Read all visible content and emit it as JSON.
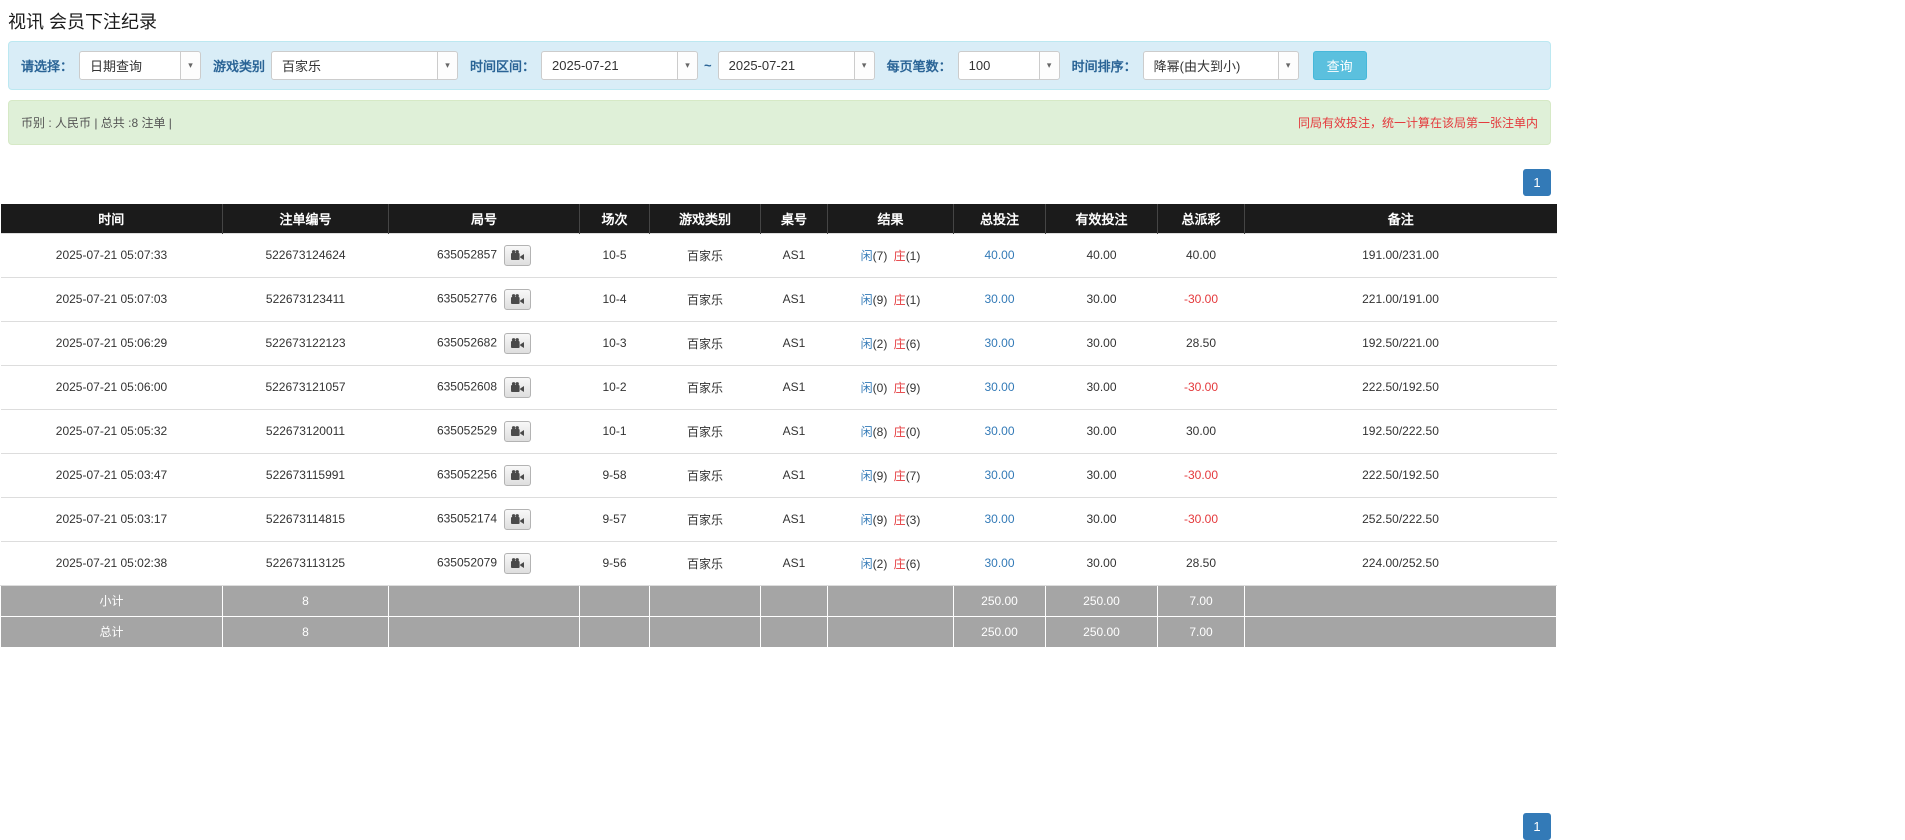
{
  "page": {
    "title": "视讯 会员下注纪录"
  },
  "filters": {
    "select_label": "请选择：",
    "select_value": "日期查询",
    "game_type_label": "游戏类别",
    "game_type_value": "百家乐",
    "date_range_label": "时间区间：",
    "date_from": "2025-07-21",
    "date_separator": "~",
    "date_to": "2025-07-21",
    "page_size_label": "每页笔数：",
    "page_size_value": "100",
    "sort_label": "时间排序：",
    "sort_value": "降幂(由大到小)",
    "search_button": "查询"
  },
  "summary": {
    "left_text": "币别 : 人民币 | 总共 :8 注单 |",
    "right_notice": "同局有效投注，统一计算在该局第一张注单内"
  },
  "pagination": {
    "page": "1"
  },
  "table": {
    "headers": [
      "时间",
      "注单编号",
      "局号",
      "场次",
      "游戏类别",
      "桌号",
      "结果",
      "总投注",
      "有效投注",
      "总派彩",
      "备注"
    ],
    "rows": [
      {
        "time": "2025-07-21 05:07:33",
        "bet_id": "522673124624",
        "round_id": "635052857",
        "session": "10-5",
        "game": "百家乐",
        "table_no": "AS1",
        "result_player": "闲",
        "result_player_score": "(7)",
        "result_banker": "庄",
        "result_banker_score": "(1)",
        "total_bet": "40.00",
        "valid_bet": "40.00",
        "payout": "40.00",
        "remark": "191.00/231.00"
      },
      {
        "time": "2025-07-21 05:07:03",
        "bet_id": "522673123411",
        "round_id": "635052776",
        "session": "10-4",
        "game": "百家乐",
        "table_no": "AS1",
        "result_player": "闲",
        "result_player_score": "(9)",
        "result_banker": "庄",
        "result_banker_score": "(1)",
        "total_bet": "30.00",
        "valid_bet": "30.00",
        "payout": "-30.00",
        "remark": "221.00/191.00"
      },
      {
        "time": "2025-07-21 05:06:29",
        "bet_id": "522673122123",
        "round_id": "635052682",
        "session": "10-3",
        "game": "百家乐",
        "table_no": "AS1",
        "result_player": "闲",
        "result_player_score": "(2)",
        "result_banker": "庄",
        "result_banker_score": "(6)",
        "total_bet": "30.00",
        "valid_bet": "30.00",
        "payout": "28.50",
        "remark": "192.50/221.00"
      },
      {
        "time": "2025-07-21 05:06:00",
        "bet_id": "522673121057",
        "round_id": "635052608",
        "session": "10-2",
        "game": "百家乐",
        "table_no": "AS1",
        "result_player": "闲",
        "result_player_score": "(0)",
        "result_banker": "庄",
        "result_banker_score": "(9)",
        "total_bet": "30.00",
        "valid_bet": "30.00",
        "payout": "-30.00",
        "remark": "222.50/192.50"
      },
      {
        "time": "2025-07-21 05:05:32",
        "bet_id": "522673120011",
        "round_id": "635052529",
        "session": "10-1",
        "game": "百家乐",
        "table_no": "AS1",
        "result_player": "闲",
        "result_player_score": "(8)",
        "result_banker": "庄",
        "result_banker_score": "(0)",
        "total_bet": "30.00",
        "valid_bet": "30.00",
        "payout": "30.00",
        "remark": "192.50/222.50"
      },
      {
        "time": "2025-07-21 05:03:47",
        "bet_id": "522673115991",
        "round_id": "635052256",
        "session": "9-58",
        "game": "百家乐",
        "table_no": "AS1",
        "result_player": "闲",
        "result_player_score": "(9)",
        "result_banker": "庄",
        "result_banker_score": "(7)",
        "total_bet": "30.00",
        "valid_bet": "30.00",
        "payout": "-30.00",
        "remark": "222.50/192.50"
      },
      {
        "time": "2025-07-21 05:03:17",
        "bet_id": "522673114815",
        "round_id": "635052174",
        "session": "9-57",
        "game": "百家乐",
        "table_no": "AS1",
        "result_player": "闲",
        "result_player_score": "(9)",
        "result_banker": "庄",
        "result_banker_score": "(3)",
        "total_bet": "30.00",
        "valid_bet": "30.00",
        "payout": "-30.00",
        "remark": "252.50/222.50"
      },
      {
        "time": "2025-07-21 05:02:38",
        "bet_id": "522673113125",
        "round_id": "635052079",
        "session": "9-56",
        "game": "百家乐",
        "table_no": "AS1",
        "result_player": "闲",
        "result_player_score": "(2)",
        "result_banker": "庄",
        "result_banker_score": "(6)",
        "total_bet": "30.00",
        "valid_bet": "30.00",
        "payout": "28.50",
        "remark": "224.00/252.50"
      }
    ],
    "subtotal": {
      "label": "小计",
      "count": "8",
      "total_bet": "250.00",
      "valid_bet": "250.00",
      "payout": "7.00"
    },
    "total": {
      "label": "总计",
      "count": "8",
      "total_bet": "250.00",
      "valid_bet": "250.00",
      "payout": "7.00"
    }
  },
  "colors": {
    "player_blue": "#337ab7",
    "banker_red": "#e4393c",
    "negative_red": "#e4393c",
    "link_blue": "#337ab7",
    "notice_red": "#e4393c",
    "query_button_blue": "#5bc0de",
    "header_black": "#1b1b1b",
    "footer_gray": "#a5a5a5",
    "filter_panel_blue": "#d9edf7",
    "summary_bar_green": "#dff0d8"
  }
}
